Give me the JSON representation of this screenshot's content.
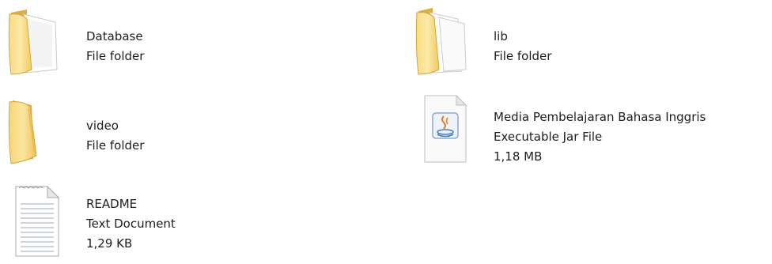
{
  "items": [
    {
      "name": "Database",
      "type": "File folder",
      "size": "",
      "icon": "folder-with-document-icon"
    },
    {
      "name": "lib",
      "type": "File folder",
      "size": "",
      "icon": "folder-with-documents-icon"
    },
    {
      "name": "video",
      "type": "File folder",
      "size": "",
      "icon": "folder-icon"
    },
    {
      "name": "Media Pembelajaran Bahasa Inggris",
      "type": "Executable Jar File",
      "size": "1,18 MB",
      "icon": "java-jar-file-icon"
    },
    {
      "name": "README",
      "type": "Text Document",
      "size": "1,29 KB",
      "icon": "text-document-icon"
    }
  ],
  "colors": {
    "folder_light": "#fbe9a6",
    "folder_mid": "#f3cd62",
    "folder_dark": "#d9a73a",
    "paper": "#f7f7f7",
    "java_blue": "#4a7dbb",
    "java_orange": "#e5801f"
  }
}
